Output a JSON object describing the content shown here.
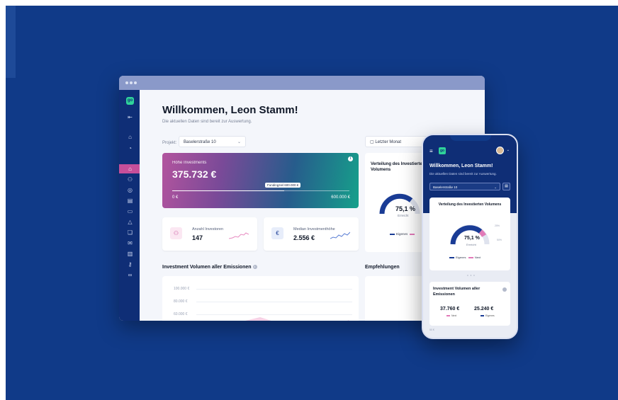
{
  "colors": {
    "background": "#103a88",
    "sidebar": "#0f2e76",
    "accent_pink": "#c64f9a",
    "accent_green": "#2fd39a",
    "donut_primary": "#1a3c95",
    "donut_secondary": "#e17ab8",
    "donut_rest": "#dfe3ee"
  },
  "desktop": {
    "logo": "go",
    "sidebar_icons": [
      "logout-icon",
      "home-icon",
      "compass-icon",
      "home-active-icon",
      "users-icon",
      "coins-icon",
      "document-icon",
      "chat-icon",
      "bell-icon",
      "gift-icon",
      "message-icon",
      "chart-icon",
      "key-icon",
      "link-icon"
    ],
    "welcome_title": "Willkommen, Leon Stamm!",
    "welcome_sub": "Die aktuellen Daten sind bereit zur Auswertung.",
    "project_label": "Projekt:",
    "project_value": "Baselerstraße 10",
    "period_value": "Letzter Monat",
    "hero": {
      "title": "Höhe Investments",
      "value": "375.732 €",
      "funding_tooltip": "Fundingziel 600.000 €",
      "min": "0 €",
      "max": "600.000 €",
      "progress_fraction": 0.63
    },
    "stats": [
      {
        "label": "Anzahl Investoren",
        "value": "147",
        "icon": "users-icon"
      },
      {
        "label": "Median Investmenthöhe",
        "value": "2.556 €",
        "icon": "euro-icon"
      }
    ],
    "distribution": {
      "title": "Verteilung des Investierten Volumens",
      "percent": "75,1 %",
      "sub": "Erreicht",
      "legend": [
        "Eigenes",
        "Next"
      ]
    },
    "volume_title": "Investment Volumen aller Emissionen",
    "recommendations_title": "Empfehlungen",
    "chart_ticks": [
      "100.000 €",
      "80.000 €",
      "60.000 €"
    ]
  },
  "phone": {
    "logo": "go",
    "welcome_title": "Willkommen, Leon Stamm!",
    "welcome_sub": "Die aktuellen Daten sind bereit zur Auswertung.",
    "project_value": "Baselerstraße 10",
    "distribution": {
      "title": "Verteilung des Investierten Volumens",
      "percent": "75,1 %",
      "sub": "Erreicht",
      "label_a": "25%",
      "label_b": "50%",
      "legend": [
        "Eigenes",
        "Next"
      ]
    },
    "pager": "• • •",
    "volume_title": "Investment Volumen aller Emissionen",
    "value_a": "37.760 €",
    "value_a_label": "Next",
    "value_b": "25.240 €",
    "value_b_label": "Eigenes",
    "bottom_tick": "50 €"
  }
}
